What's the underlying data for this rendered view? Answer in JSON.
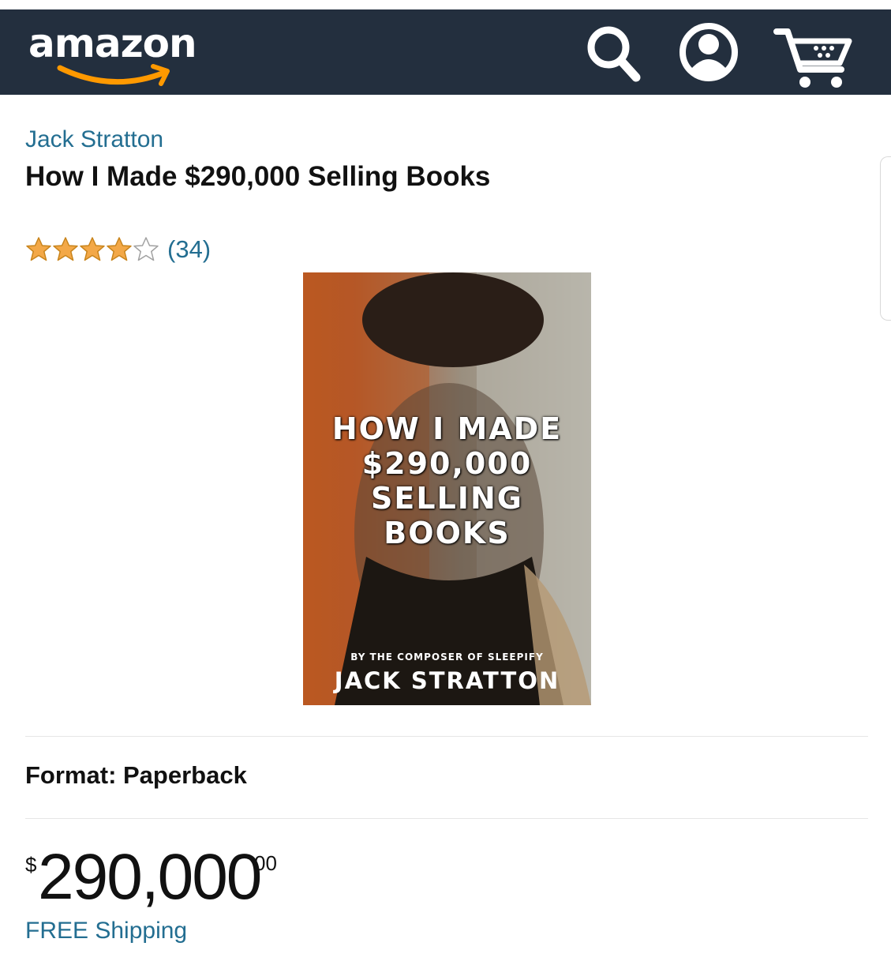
{
  "header": {
    "logo_text": "amazon",
    "icons": [
      "search-icon",
      "account-icon",
      "cart-icon"
    ],
    "background": "#232f3e",
    "logo_smile_color": "#ff9900"
  },
  "product": {
    "author": "Jack Stratton",
    "title": "How I Made $290,000 Selling Books",
    "rating": {
      "stars": 4,
      "max": 5,
      "review_count": "(34)"
    },
    "cover": {
      "title_lines": [
        "HOW I MADE",
        "$290,000",
        "SELLING",
        "BOOKS"
      ],
      "subtitle": "BY THE COMPOSER OF SLEEPIFY",
      "author": "JACK STRATTON"
    },
    "format": "Format: Paperback",
    "price": {
      "symbol": "$",
      "whole": "290,000",
      "fraction": "00"
    },
    "shipping": "FREE Shipping"
  },
  "colors": {
    "link": "#236e91",
    "star": "#f3a847"
  }
}
